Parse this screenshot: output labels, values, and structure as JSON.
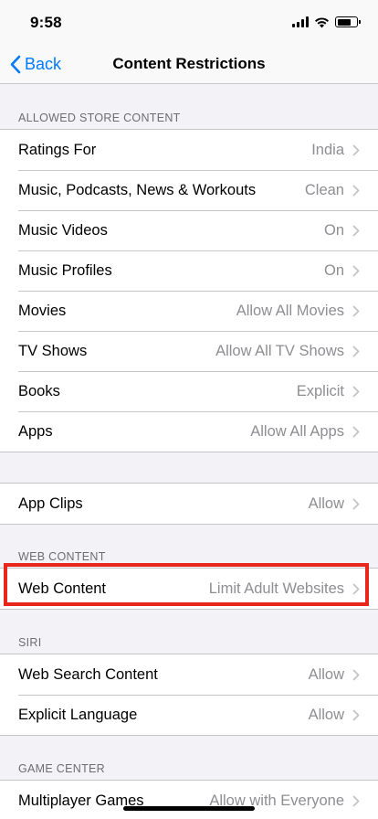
{
  "status_bar": {
    "time": "9:58",
    "battery_level": 0.7
  },
  "nav": {
    "back_label": "Back",
    "title": "Content Restrictions"
  },
  "sections": {
    "allowed_store_content": {
      "header": "ALLOWED STORE CONTENT",
      "rows": [
        {
          "label": "Ratings For",
          "value": "India"
        },
        {
          "label": "Music, Podcasts, News & Workouts",
          "value": "Clean"
        },
        {
          "label": "Music Videos",
          "value": "On"
        },
        {
          "label": "Music Profiles",
          "value": "On"
        },
        {
          "label": "Movies",
          "value": "Allow All Movies"
        },
        {
          "label": "TV Shows",
          "value": "Allow All TV Shows"
        },
        {
          "label": "Books",
          "value": "Explicit"
        },
        {
          "label": "Apps",
          "value": "Allow All Apps"
        }
      ]
    },
    "app_clips": {
      "rows": [
        {
          "label": "App Clips",
          "value": "Allow"
        }
      ]
    },
    "web_content": {
      "header": "WEB CONTENT",
      "rows": [
        {
          "label": "Web Content",
          "value": "Limit Adult Websites"
        }
      ]
    },
    "siri": {
      "header": "SIRI",
      "rows": [
        {
          "label": "Web Search Content",
          "value": "Allow"
        },
        {
          "label": "Explicit Language",
          "value": "Allow"
        }
      ]
    },
    "game_center": {
      "header": "GAME CENTER",
      "rows": [
        {
          "label": "Multiplayer Games",
          "value": "Allow with Everyone"
        }
      ]
    }
  },
  "colors": {
    "accent": "#007aff",
    "highlight": "#e8261c",
    "secondary_text": "#8e8e93",
    "background": "#f2f2f7"
  }
}
